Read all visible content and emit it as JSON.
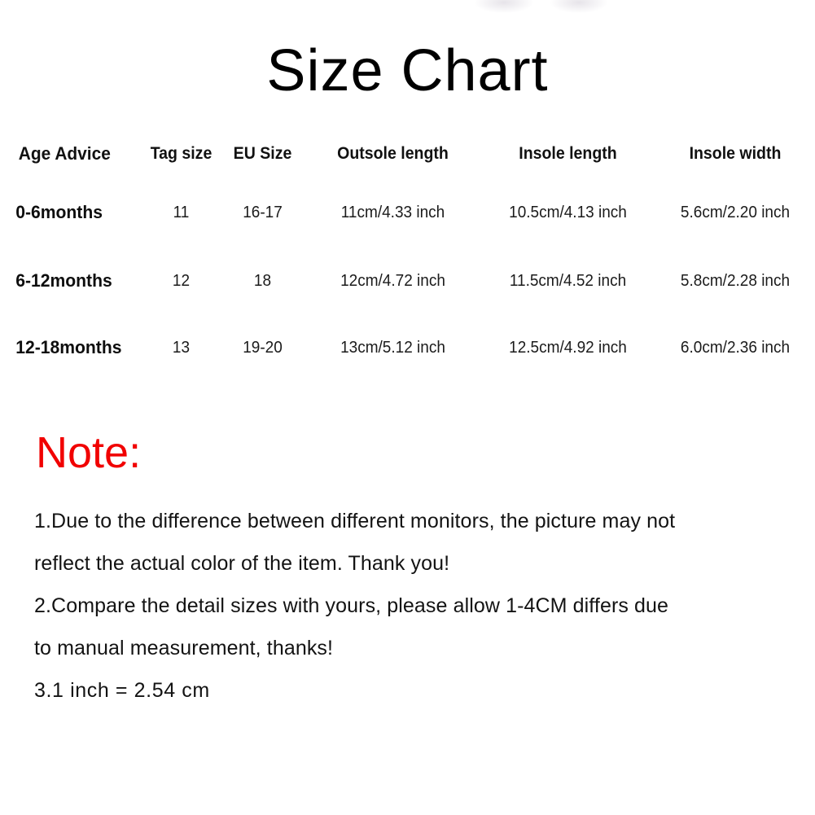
{
  "page": {
    "title": "Size Chart"
  },
  "table": {
    "headers": [
      "Age Advice",
      "Tag size",
      "EU Size",
      "Outsole length",
      "Insole length",
      "Insole width"
    ],
    "rows": [
      {
        "age_advice": "0-6months",
        "tag_size": "11",
        "eu_size": "16-17",
        "outsole_length": "11cm/4.33 inch",
        "insole_length": "10.5cm/4.13 inch",
        "insole_width": "5.6cm/2.20 inch"
      },
      {
        "age_advice": "6-12months",
        "tag_size": "12",
        "eu_size": "18",
        "outsole_length": "12cm/4.72 inch",
        "insole_length": "11.5cm/4.52 inch",
        "insole_width": "5.8cm/2.28 inch"
      },
      {
        "age_advice": "12-18months",
        "tag_size": "13",
        "eu_size": "19-20",
        "outsole_length": "13cm/5.12 inch",
        "insole_length": "12.5cm/4.92 inch",
        "insole_width": "6.0cm/2.36 inch"
      }
    ]
  },
  "note": {
    "heading": "Note:",
    "heading_color": "#f10000",
    "lines": [
      "1.Due to the difference between different monitors, the picture may not",
      "reflect the actual color of the item. Thank you!",
      "2.Compare the detail sizes with yours, please allow 1-4CM differs due",
      "to manual measurement, thanks!",
      "3.1 inch = 2.54 cm"
    ]
  }
}
